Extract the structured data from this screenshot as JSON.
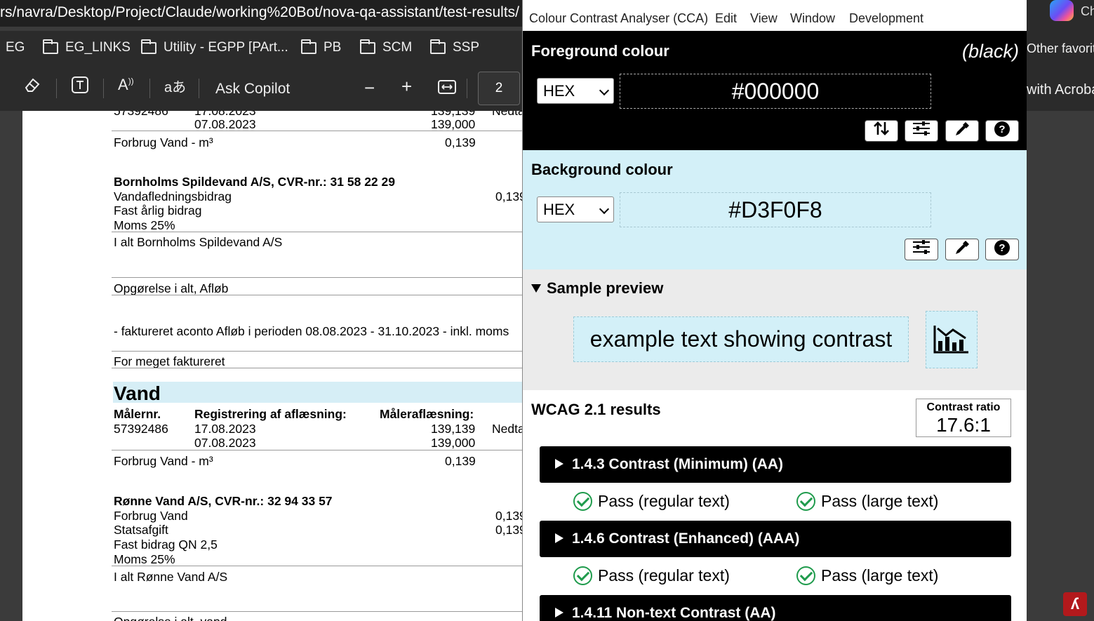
{
  "browser": {
    "address_url": "rs/navra/Desktop/Project/Claude/working%20Bot/nova-qa-assistant/test-results/",
    "tab_partial": "Ch",
    "bookmarks": [
      "EG",
      "EG_LINKS",
      "Utility - EGPP [PArt...",
      "PB",
      "SCM",
      "SSP"
    ],
    "bookmarks_overflow": "Other favorite",
    "pdf_toolbar": {
      "ask_copilot": "Ask Copilot",
      "page_number": "2",
      "open_with": "with Acroba"
    }
  },
  "document": {
    "top_meter_partial": "57392486",
    "top_date_partial": "17.08.2023",
    "top_reading_partial": "139,139",
    "top_status_partial": "Nedta",
    "top_date2": "07.08.2023",
    "top_reading2": "139,000",
    "top_forbrug": "Forbrug Vand - m³",
    "top_forbrug_val": "0,139",
    "spildevand_heading": "Bornholms Spildevand A/S, CVR-nr.: 31 58 22 29",
    "spildevand_items": [
      "Vandafledningsbidrag",
      "Fast årlig bidrag",
      "Moms 25%"
    ],
    "spildevand_val": "0,139",
    "spildevand_total": "I alt Bornholms Spildevand A/S",
    "opgorelse_afloeb": "Opgørelse i alt, Afløb",
    "aconto_line": "- faktureret aconto Afløb i perioden 08.08.2023 - 31.10.2023 - inkl. moms",
    "for_meget": "For meget faktureret",
    "vand_heading": "Vand",
    "col_maler": "Målernr.",
    "col_reg": "Registrering af aflæsning:",
    "col_aflaes": "Måleraflæsning:",
    "meter": "57392486",
    "date1": "17.08.2023",
    "reading1": "139,139",
    "status_partial": "Nedta",
    "date2": "07.08.2023",
    "reading2": "139,000",
    "forbrug": "Forbrug Vand - m³",
    "forbrug_val": "0,139",
    "ronne_heading": "Rønne Vand A/S, CVR-nr.: 32 94 33 57",
    "ronne_items": [
      "Forbrug Vand",
      "Statsafgift",
      "Fast bidrag QN 2,5",
      "Moms 25%"
    ],
    "ronne_vals": [
      "0,139",
      "0,139"
    ],
    "ronne_total": "I alt Rønne Vand A/S",
    "opgorelse_vand_partial": "Opgørelse i alt, vand"
  },
  "cca": {
    "menu": [
      "Colour Contrast Analyser (CCA)",
      "Edit",
      "View",
      "Window",
      "Development"
    ],
    "foreground": {
      "title": "Foreground colour",
      "name": "(black)",
      "format": "HEX",
      "value": "#000000",
      "color": "#000000"
    },
    "background": {
      "title": "Background colour",
      "format": "HEX",
      "value": "#D3F0F8",
      "color": "#D3F0F8"
    },
    "preview": {
      "title": "Sample preview",
      "sample_text": "example text showing contrast"
    },
    "results": {
      "title": "WCAG 2.1 results",
      "ratio_label": "Contrast ratio",
      "ratio_value": "17.6:1",
      "criteria": [
        {
          "label": "1.4.3 Contrast (Minimum) (AA)",
          "regular": "Pass (regular text)",
          "large": "Pass (large text)"
        },
        {
          "label": "1.4.6 Contrast (Enhanced) (AAA)",
          "regular": "Pass (regular text)",
          "large": "Pass (large text)"
        },
        {
          "label": "1.4.11 Non-text Contrast (AA)"
        }
      ],
      "pass_color": "#1f9b4c"
    }
  }
}
